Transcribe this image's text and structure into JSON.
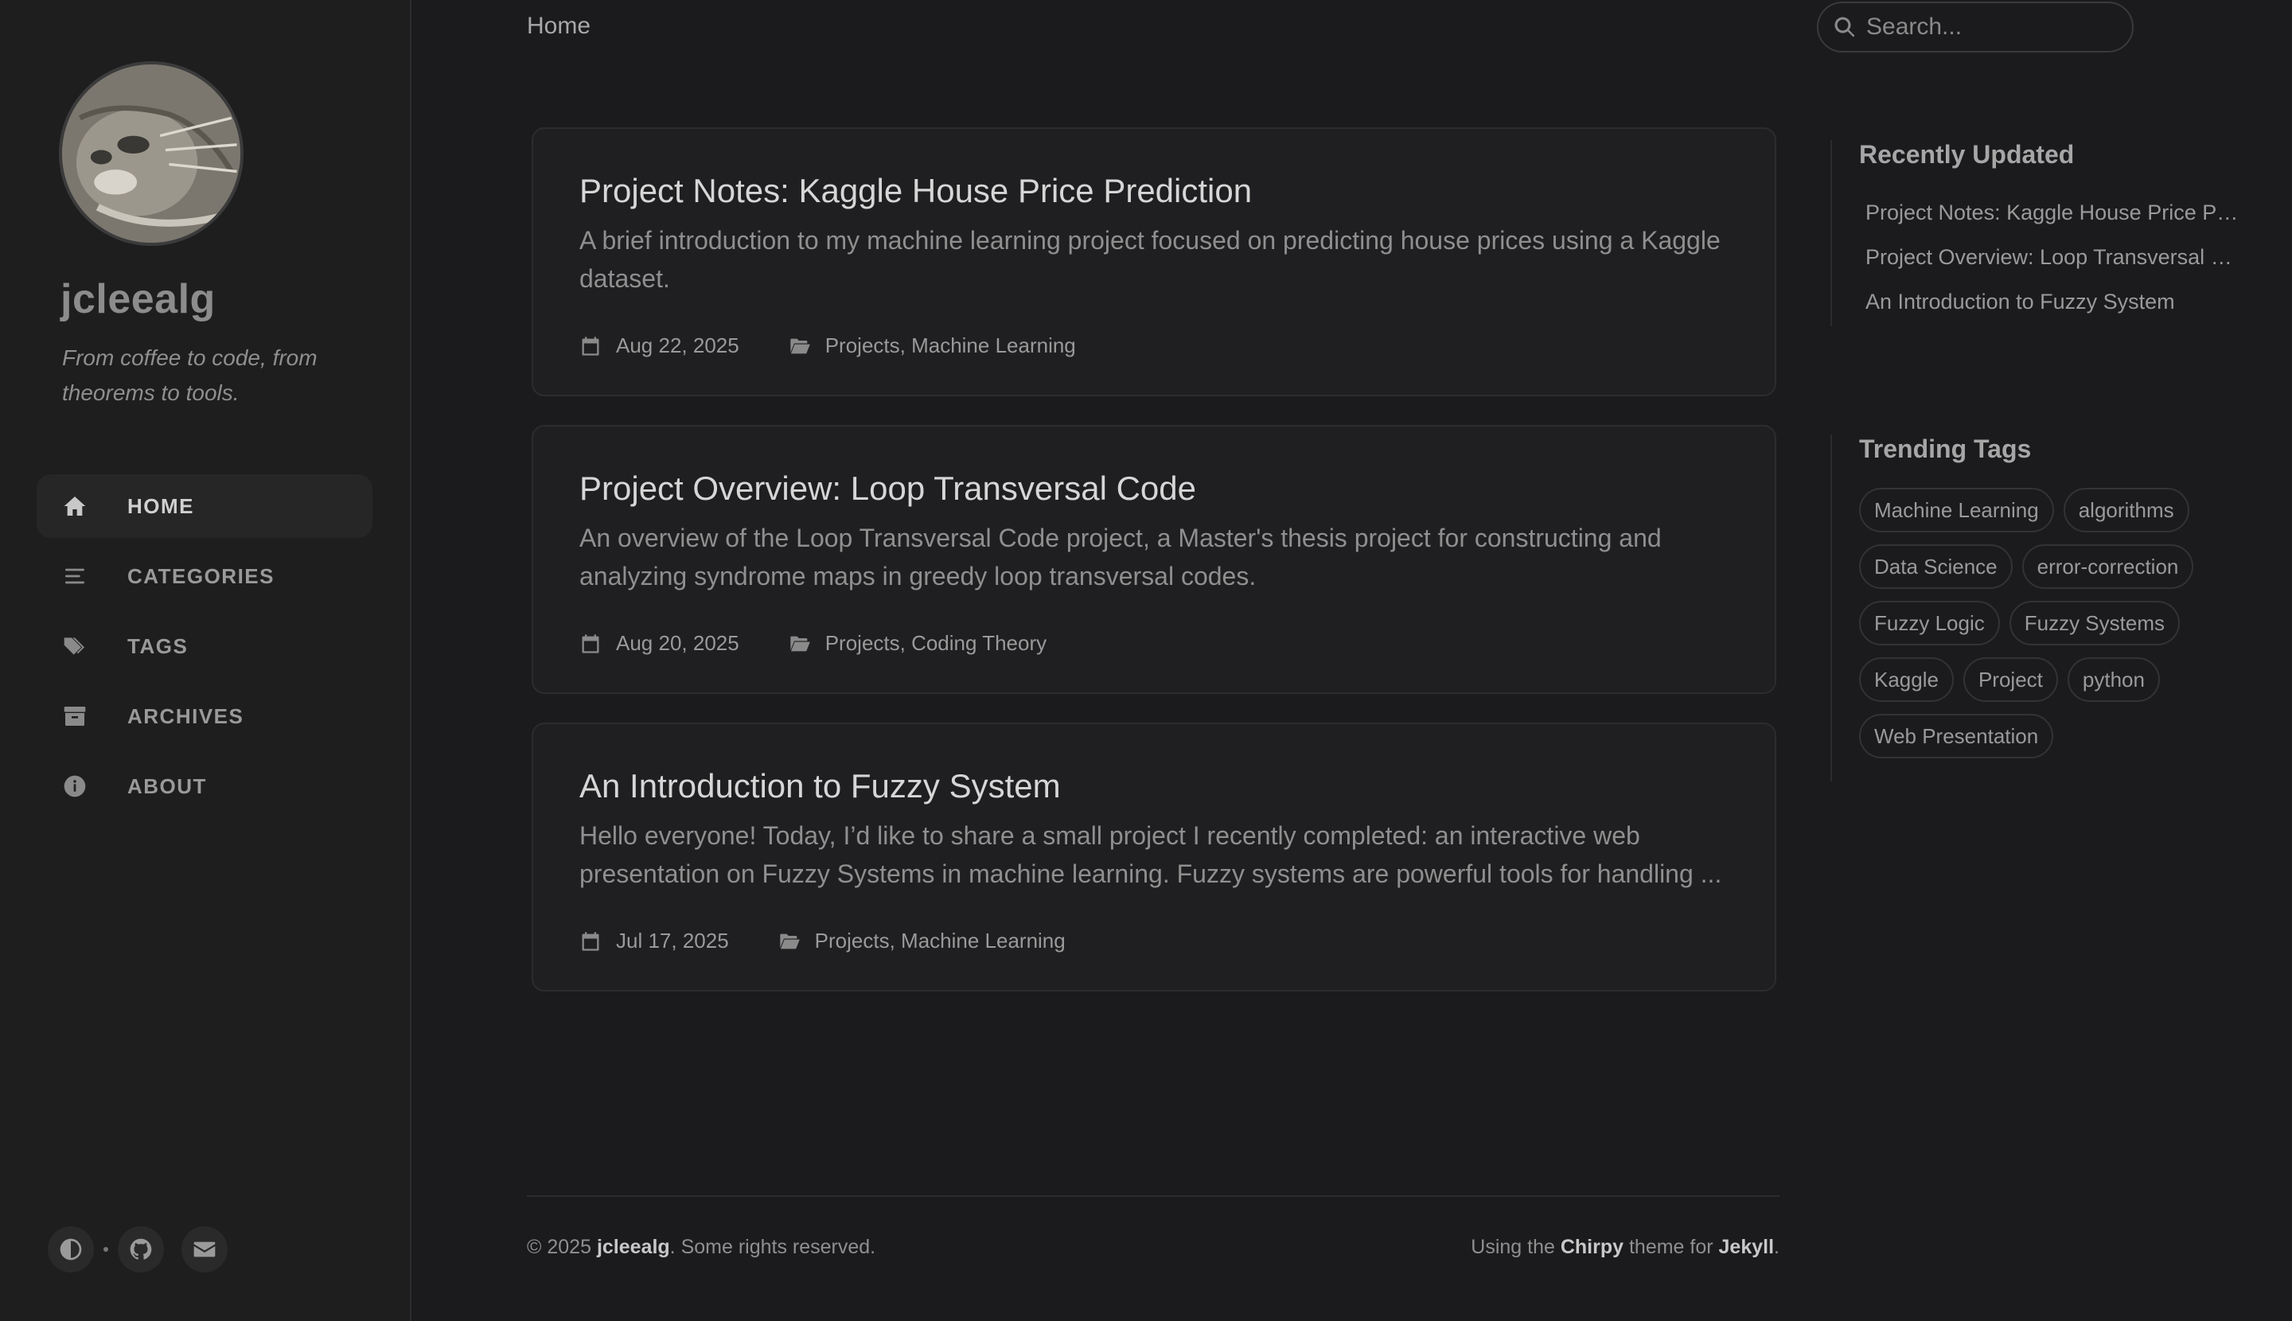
{
  "sidebar": {
    "title": "jcleealg",
    "subtitle": "From coffee to code, from theorems to tools.",
    "nav": [
      {
        "label": "HOME",
        "icon": "home-icon",
        "active": true
      },
      {
        "label": "CATEGORIES",
        "icon": "stream-icon",
        "active": false
      },
      {
        "label": "TAGS",
        "icon": "tags-icon",
        "active": false
      },
      {
        "label": "ARCHIVES",
        "icon": "archive-icon",
        "active": false
      },
      {
        "label": "ABOUT",
        "icon": "info-icon",
        "active": false
      }
    ],
    "bottom_icons": [
      "theme-toggle-icon",
      "github-icon",
      "email-icon"
    ]
  },
  "topbar": {
    "breadcrumb": "Home",
    "search_placeholder": "Search..."
  },
  "posts": [
    {
      "title": "Project Notes: Kaggle House Price Prediction",
      "description": "A brief introduction to my machine learning project focused on predicting house prices using a Kaggle dataset.",
      "date": "Aug 22, 2025",
      "categories": "Projects, Machine Learning"
    },
    {
      "title": "Project Overview: Loop Transversal Code",
      "description": "An overview of the Loop Transversal Code project, a Master's thesis project for constructing and analyzing syndrome maps in greedy loop transversal codes.",
      "date": "Aug 20, 2025",
      "categories": "Projects, Coding Theory"
    },
    {
      "title": "An Introduction to Fuzzy System",
      "description": "Hello everyone! Today, I’d like to share a small project I recently completed: an interactive web presentation on Fuzzy Systems in machine learning. Fuzzy systems are powerful tools for handling ...",
      "date": "Jul 17, 2025",
      "categories": "Projects, Machine Learning"
    }
  ],
  "recently_updated": {
    "title": "Recently Updated",
    "items": [
      "Project Notes: Kaggle House Price Prediction",
      "Project Overview: Loop Transversal Code",
      "An Introduction to Fuzzy System"
    ]
  },
  "trending_tags": {
    "title": "Trending Tags",
    "tags": [
      "Machine Learning",
      "algorithms",
      "Data Science",
      "error-correction",
      "Fuzzy Logic",
      "Fuzzy Systems",
      "Kaggle",
      "Project",
      "python",
      "Web Presentation"
    ]
  },
  "footer": {
    "copyright_prefix": "© 2025 ",
    "author": "jcleealg",
    "copyright_suffix": ". Some rights reserved.",
    "using_prefix": "Using the ",
    "theme": "Chirpy",
    "theme_mid": " theme for ",
    "engine": "Jekyll",
    "engine_suffix": "."
  },
  "colors": {
    "background": "#1b1b1e",
    "sidebar": "#1e1e1e",
    "card": "#1f1f21",
    "border": "#2c2c2e"
  }
}
